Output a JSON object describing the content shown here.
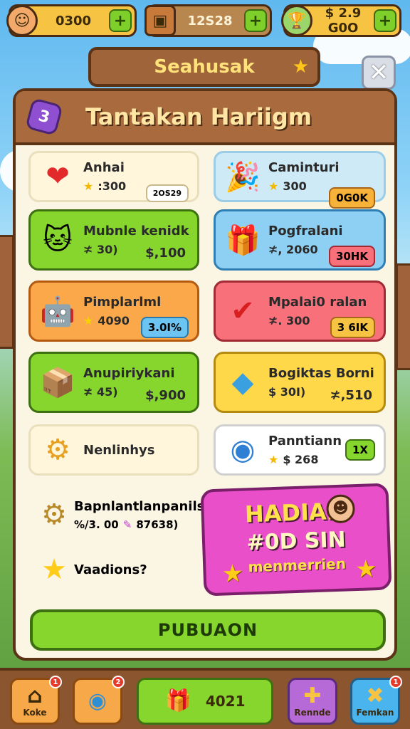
{
  "topbar": {
    "coins": {
      "value": "0300",
      "icon": "avatar-face-icon"
    },
    "chest": {
      "value": "12S28",
      "icon": "treasure-chest-icon"
    },
    "trophy": {
      "value": "$ 2.9 G0O",
      "icon": "trophy-icon"
    },
    "plus": "+"
  },
  "header": {
    "banner_title": "Seahusak",
    "close": "✕"
  },
  "panel": {
    "badge": "3",
    "title": "Tantakan Hariigm"
  },
  "tasks": [
    {
      "name": "Anhai",
      "sub": ":300",
      "tag": "2OS29",
      "icon": "heart-icon"
    },
    {
      "name": "Caminturi",
      "sub": "300",
      "tag": "0G0K",
      "icon": "party-hat-icon"
    },
    {
      "name": "Mubnle kenidk",
      "sub": "≭ 30)",
      "tag": "$,100",
      "icon": "cat-face-icon"
    },
    {
      "name": "Pogfralani",
      "sub": "≭, 2060",
      "tag": "30HK",
      "icon": "gift-box-icon"
    },
    {
      "name": "Pimplarlml",
      "sub": "4090",
      "tag": "3.0I%",
      "icon": "robot-icon"
    },
    {
      "name": "Mpalai0 ralan",
      "sub": "≭. 300",
      "tag": "3 6IK",
      "icon": "checkmark-icon"
    },
    {
      "name": "Anupiriykani",
      "sub": "≭ 45)",
      "tag": "$,900",
      "icon": "crate-icon"
    },
    {
      "name": "Bogiktas Borni",
      "sub": "$ 30I)",
      "tag": "≭,510",
      "icon": "gem-icon"
    },
    {
      "name": "Nenlinhys",
      "icon": "rolling-pin-icon"
    },
    {
      "name": "Panntiann",
      "sub": "$ 268",
      "tag": "1X",
      "icon": "coin-icon"
    }
  ],
  "bottom_left": {
    "row1_name": "Bapnlantlanpanils",
    "row1_sub": "%/3. 00",
    "row1_tag": "87638)",
    "row2_name": "Vaadions?"
  },
  "reward": {
    "title": "HADIAH",
    "subtitle": "#0D SIN",
    "caption": "menmerrien"
  },
  "cta_label": "PUBUAON",
  "nav": [
    {
      "label": "Koke",
      "icon": "home-icon",
      "badge": "1"
    },
    {
      "label": "",
      "icon": "map-pin-icon",
      "badge": "2"
    },
    {
      "label": "4021",
      "icon": "gift-icon"
    },
    {
      "label": "Rennde",
      "icon": "puzzle-icon"
    },
    {
      "label": "Femkan",
      "icon": "tools-icon",
      "badge": "1"
    }
  ],
  "colors": {
    "green": "#86d62e",
    "blue": "#8dd0f4",
    "orange": "#fba84a",
    "red": "#f7707a",
    "yellow": "#ffd84a",
    "cream": "#fff6dc",
    "pink": "#e84fc8"
  }
}
